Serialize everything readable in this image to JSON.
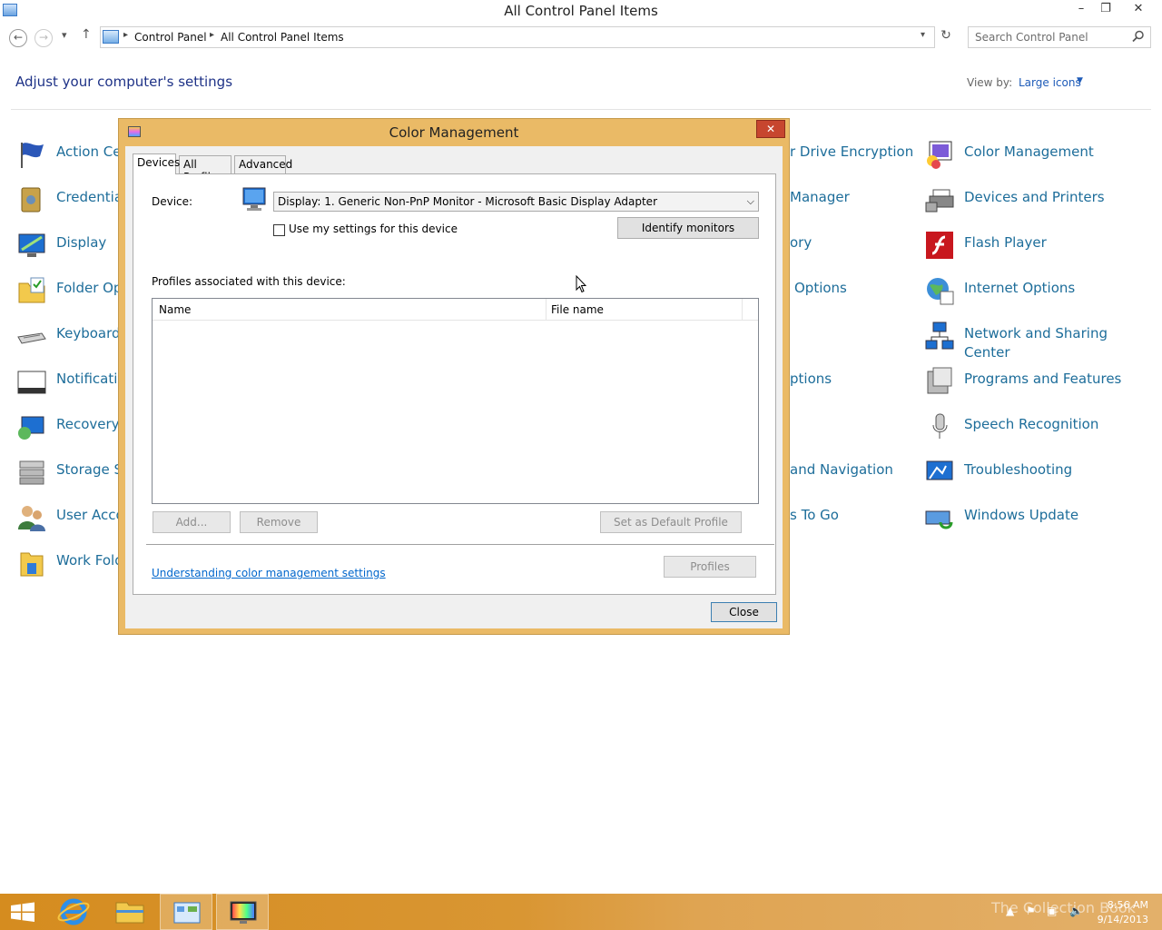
{
  "window": {
    "title": "All Control Panel Items",
    "minimize": "–",
    "restore": "❐",
    "close": "✕"
  },
  "address": {
    "crumbs": [
      "Control Panel",
      "All Control Panel Items"
    ],
    "search_placeholder": "Search Control Panel"
  },
  "header": {
    "heading": "Adjust your computer's settings",
    "view_by_label": "View by:",
    "view_by_value": "Large icons"
  },
  "items": [
    {
      "label": "Action Ce"
    },
    {
      "label": "Credentia"
    },
    {
      "label": "Display"
    },
    {
      "label": "Folder Op"
    },
    {
      "label": "Keyboard"
    },
    {
      "label": "Notificatio"
    },
    {
      "label": "Recovery"
    },
    {
      "label": "Storage S"
    },
    {
      "label": "User Acco"
    },
    {
      "label": "Work Fold"
    },
    {
      "label": "r Drive Encryption"
    },
    {
      "label": "Manager"
    },
    {
      "label": "ory"
    },
    {
      "label": "Options"
    },
    {
      "label": "ptions"
    },
    {
      "label": "and Navigation"
    },
    {
      "label": "s To Go"
    },
    {
      "label": "Color Management"
    },
    {
      "label": "Devices and Printers"
    },
    {
      "label": "Flash Player"
    },
    {
      "label": "Internet Options"
    },
    {
      "label": "Network and Sharing Center"
    },
    {
      "label": "Programs and Features"
    },
    {
      "label": "Speech Recognition"
    },
    {
      "label": "Troubleshooting"
    },
    {
      "label": "Windows Update"
    }
  ],
  "dialog": {
    "title": "Color Management",
    "close_glyph": "✕",
    "tabs": [
      "Devices",
      "All Profiles",
      "Advanced"
    ],
    "device_label": "Device:",
    "device_value": "Display: 1. Generic Non-PnP Monitor - Microsoft Basic Display Adapter",
    "use_my_settings": "Use my settings for this device",
    "identify_monitors": "Identify monitors",
    "profiles_label": "Profiles associated with this device:",
    "columns": [
      "Name",
      "File name"
    ],
    "add": "Add...",
    "remove": "Remove",
    "set_default": "Set as Default Profile",
    "link": "Understanding color management settings",
    "profiles": "Profiles",
    "close": "Close"
  },
  "taskbar": {
    "time": "8:56 AM",
    "date": "9/14/2013",
    "watermark": "The Collection Book"
  }
}
